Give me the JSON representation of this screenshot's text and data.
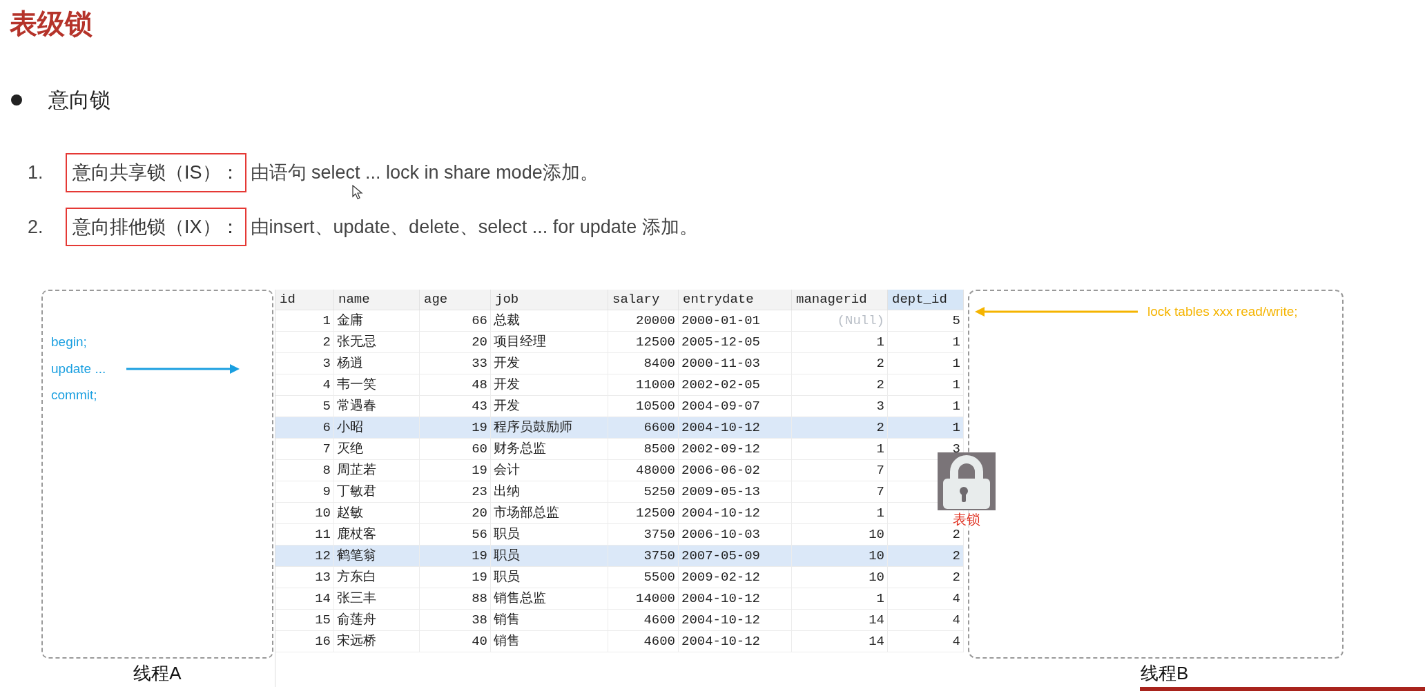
{
  "title": "表级锁",
  "bullet": "意向锁",
  "items": [
    {
      "number": "1.",
      "term": "意向共享锁（IS）：",
      "text": "由语句 select ... lock  in share mode添加。"
    },
    {
      "number": "2.",
      "term": "意向排他锁（IX）：",
      "text": "由insert、update、delete、select ... for update 添加。"
    }
  ],
  "thread_a": {
    "lines": [
      "begin;",
      "update ...",
      "commit;"
    ],
    "label": "线程A"
  },
  "thread_b": {
    "command": "lock tables xxx read/write;",
    "label": "线程B"
  },
  "table": {
    "columns": [
      {
        "label": "id",
        "selected": false
      },
      {
        "label": "name",
        "selected": false
      },
      {
        "label": "age",
        "selected": false
      },
      {
        "label": "job",
        "selected": false
      },
      {
        "label": "salary",
        "selected": false
      },
      {
        "label": "entrydate",
        "selected": false
      },
      {
        "label": "managerid",
        "selected": false
      },
      {
        "label": "dept_id",
        "selected": true
      }
    ],
    "rows": [
      {
        "highlighted": false,
        "cells": [
          "1",
          "金庸",
          "66",
          "总裁",
          "20000",
          "2000-01-01",
          "(Null)",
          "5"
        ]
      },
      {
        "highlighted": false,
        "cells": [
          "2",
          "张无忌",
          "20",
          "项目经理",
          "12500",
          "2005-12-05",
          "1",
          "1"
        ]
      },
      {
        "highlighted": false,
        "cells": [
          "3",
          "杨逍",
          "33",
          "开发",
          "8400",
          "2000-11-03",
          "2",
          "1"
        ]
      },
      {
        "highlighted": false,
        "cells": [
          "4",
          "韦一笑",
          "48",
          "开发",
          "11000",
          "2002-02-05",
          "2",
          "1"
        ]
      },
      {
        "highlighted": false,
        "cells": [
          "5",
          "常遇春",
          "43",
          "开发",
          "10500",
          "2004-09-07",
          "3",
          "1"
        ]
      },
      {
        "highlighted": true,
        "cells": [
          "6",
          "小昭",
          "19",
          "程序员鼓励师",
          "6600",
          "2004-10-12",
          "2",
          "1"
        ]
      },
      {
        "highlighted": false,
        "cells": [
          "7",
          "灭绝",
          "60",
          "财务总监",
          "8500",
          "2002-09-12",
          "1",
          "3"
        ]
      },
      {
        "highlighted": false,
        "cells": [
          "8",
          "周芷若",
          "19",
          "会计",
          "48000",
          "2006-06-02",
          "7"
        ]
      },
      {
        "highlighted": false,
        "cells": [
          "9",
          "丁敏君",
          "23",
          "出纳",
          "5250",
          "2009-05-13",
          "7"
        ]
      },
      {
        "highlighted": false,
        "cells": [
          "10",
          "赵敏",
          "20",
          "市场部总监",
          "12500",
          "2004-10-12",
          "1"
        ]
      },
      {
        "highlighted": false,
        "cells": [
          "11",
          "鹿杖客",
          "56",
          "职员",
          "3750",
          "2006-10-03",
          "10",
          "2"
        ]
      },
      {
        "highlighted": true,
        "cells": [
          "12",
          "鹤笔翁",
          "19",
          "职员",
          "3750",
          "2007-05-09",
          "10",
          "2"
        ]
      },
      {
        "highlighted": false,
        "cells": [
          "13",
          "方东白",
          "19",
          "职员",
          "5500",
          "2009-02-12",
          "10",
          "2"
        ]
      },
      {
        "highlighted": false,
        "cells": [
          "14",
          "张三丰",
          "88",
          "销售总监",
          "14000",
          "2004-10-12",
          "1",
          "4"
        ]
      },
      {
        "highlighted": false,
        "cells": [
          "15",
          "俞莲舟",
          "38",
          "销售",
          "4600",
          "2004-10-12",
          "14",
          "4"
        ]
      },
      {
        "highlighted": false,
        "cells": [
          "16",
          "宋远桥",
          "40",
          "销售",
          "4600",
          "2004-10-12",
          "14",
          "4"
        ]
      }
    ]
  },
  "lock_label": "表锁",
  "bottom_bar": {
    "level": 0.2
  }
}
